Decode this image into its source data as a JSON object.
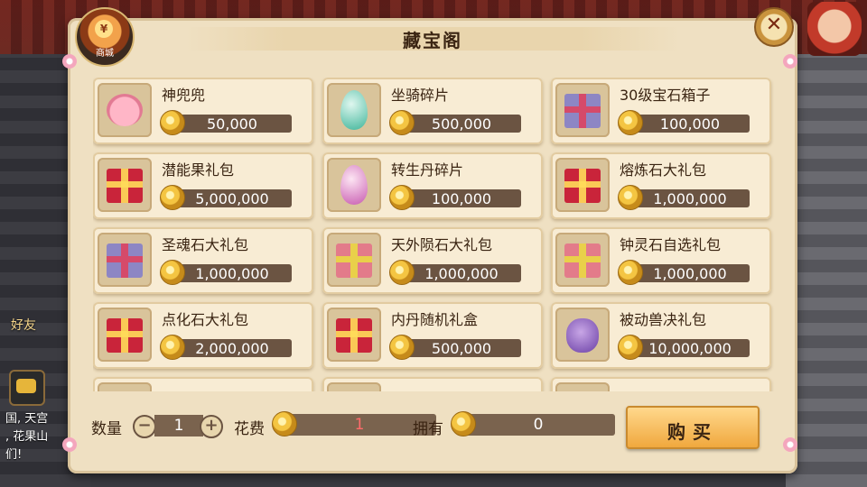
{
  "background": {
    "friends_label": "好友",
    "chat_lines": [
      "国, 天宫",
      ", 花果山",
      "们!"
    ]
  },
  "panel": {
    "title": "藏宝阁",
    "shop_badge_label": "商城",
    "shop_badge_coin": "¥"
  },
  "items": [
    {
      "name": "神兜兜",
      "price": "50,000",
      "icon": "pig-icon"
    },
    {
      "name": "坐骑碎片",
      "price": "500,000",
      "icon": "green-egg-icon"
    },
    {
      "name": "30级宝石箱子",
      "price": "100,000",
      "icon": "blue-gift-icon"
    },
    {
      "name": "潜能果礼包",
      "price": "5,000,000",
      "icon": "red-gift-icon"
    },
    {
      "name": "转生丹碎片",
      "price": "100,000",
      "icon": "pink-egg-icon"
    },
    {
      "name": "熔炼石大礼包",
      "price": "1,000,000",
      "icon": "red-gift-icon"
    },
    {
      "name": "圣魂石大礼包",
      "price": "1,000,000",
      "icon": "blue-gift-icon"
    },
    {
      "name": "天外陨石大礼包",
      "price": "1,000,000",
      "icon": "pink-gift-icon"
    },
    {
      "name": "钟灵石自选礼包",
      "price": "1,000,000",
      "icon": "pink-gift-icon"
    },
    {
      "name": "点化石大礼包",
      "price": "2,000,000",
      "icon": "red-gift-icon"
    },
    {
      "name": "内丹随机礼盒",
      "price": "500,000",
      "icon": "red-gift-icon"
    },
    {
      "name": "被动兽决礼包",
      "price": "10,000,000",
      "icon": "purple-bag-icon"
    }
  ],
  "purchase": {
    "quantity_label": "数量",
    "quantity": "1",
    "minus": "−",
    "plus": "+",
    "cost_label": "花费",
    "cost": "1",
    "owned_label": "拥有",
    "owned": "0",
    "buy_label": "购买",
    "close_symbol": "✕"
  },
  "colors": {
    "panel_bg": "#efe0c2",
    "price_bar": "#6b5442",
    "buy_button": "#f0a83e",
    "cost_text": "#ff6b6b"
  }
}
